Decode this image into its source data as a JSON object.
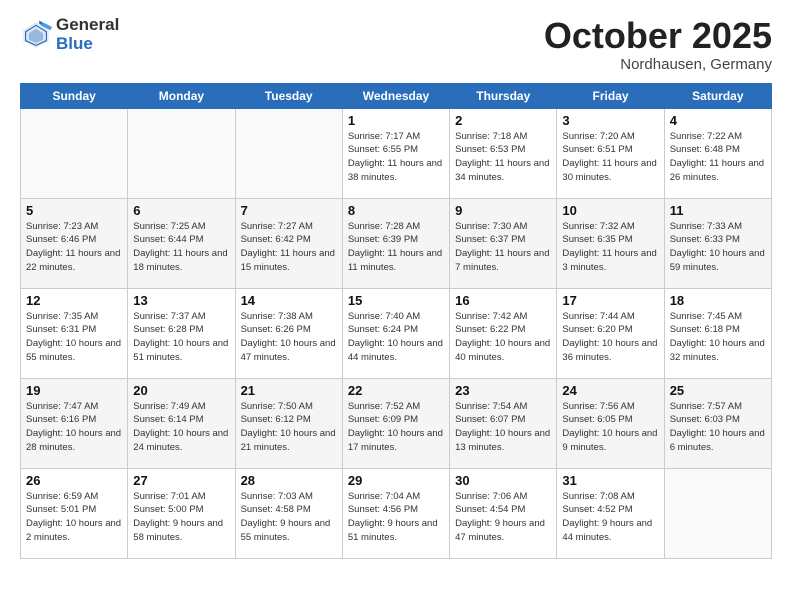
{
  "header": {
    "logo_general": "General",
    "logo_blue": "Blue",
    "month": "October 2025",
    "location": "Nordhausen, Germany"
  },
  "days_of_week": [
    "Sunday",
    "Monday",
    "Tuesday",
    "Wednesday",
    "Thursday",
    "Friday",
    "Saturday"
  ],
  "weeks": [
    [
      {
        "day": "",
        "sunrise": "",
        "sunset": "",
        "daylight": ""
      },
      {
        "day": "",
        "sunrise": "",
        "sunset": "",
        "daylight": ""
      },
      {
        "day": "",
        "sunrise": "",
        "sunset": "",
        "daylight": ""
      },
      {
        "day": "1",
        "sunrise": "Sunrise: 7:17 AM",
        "sunset": "Sunset: 6:55 PM",
        "daylight": "Daylight: 11 hours and 38 minutes."
      },
      {
        "day": "2",
        "sunrise": "Sunrise: 7:18 AM",
        "sunset": "Sunset: 6:53 PM",
        "daylight": "Daylight: 11 hours and 34 minutes."
      },
      {
        "day": "3",
        "sunrise": "Sunrise: 7:20 AM",
        "sunset": "Sunset: 6:51 PM",
        "daylight": "Daylight: 11 hours and 30 minutes."
      },
      {
        "day": "4",
        "sunrise": "Sunrise: 7:22 AM",
        "sunset": "Sunset: 6:48 PM",
        "daylight": "Daylight: 11 hours and 26 minutes."
      }
    ],
    [
      {
        "day": "5",
        "sunrise": "Sunrise: 7:23 AM",
        "sunset": "Sunset: 6:46 PM",
        "daylight": "Daylight: 11 hours and 22 minutes."
      },
      {
        "day": "6",
        "sunrise": "Sunrise: 7:25 AM",
        "sunset": "Sunset: 6:44 PM",
        "daylight": "Daylight: 11 hours and 18 minutes."
      },
      {
        "day": "7",
        "sunrise": "Sunrise: 7:27 AM",
        "sunset": "Sunset: 6:42 PM",
        "daylight": "Daylight: 11 hours and 15 minutes."
      },
      {
        "day": "8",
        "sunrise": "Sunrise: 7:28 AM",
        "sunset": "Sunset: 6:39 PM",
        "daylight": "Daylight: 11 hours and 11 minutes."
      },
      {
        "day": "9",
        "sunrise": "Sunrise: 7:30 AM",
        "sunset": "Sunset: 6:37 PM",
        "daylight": "Daylight: 11 hours and 7 minutes."
      },
      {
        "day": "10",
        "sunrise": "Sunrise: 7:32 AM",
        "sunset": "Sunset: 6:35 PM",
        "daylight": "Daylight: 11 hours and 3 minutes."
      },
      {
        "day": "11",
        "sunrise": "Sunrise: 7:33 AM",
        "sunset": "Sunset: 6:33 PM",
        "daylight": "Daylight: 10 hours and 59 minutes."
      }
    ],
    [
      {
        "day": "12",
        "sunrise": "Sunrise: 7:35 AM",
        "sunset": "Sunset: 6:31 PM",
        "daylight": "Daylight: 10 hours and 55 minutes."
      },
      {
        "day": "13",
        "sunrise": "Sunrise: 7:37 AM",
        "sunset": "Sunset: 6:28 PM",
        "daylight": "Daylight: 10 hours and 51 minutes."
      },
      {
        "day": "14",
        "sunrise": "Sunrise: 7:38 AM",
        "sunset": "Sunset: 6:26 PM",
        "daylight": "Daylight: 10 hours and 47 minutes."
      },
      {
        "day": "15",
        "sunrise": "Sunrise: 7:40 AM",
        "sunset": "Sunset: 6:24 PM",
        "daylight": "Daylight: 10 hours and 44 minutes."
      },
      {
        "day": "16",
        "sunrise": "Sunrise: 7:42 AM",
        "sunset": "Sunset: 6:22 PM",
        "daylight": "Daylight: 10 hours and 40 minutes."
      },
      {
        "day": "17",
        "sunrise": "Sunrise: 7:44 AM",
        "sunset": "Sunset: 6:20 PM",
        "daylight": "Daylight: 10 hours and 36 minutes."
      },
      {
        "day": "18",
        "sunrise": "Sunrise: 7:45 AM",
        "sunset": "Sunset: 6:18 PM",
        "daylight": "Daylight: 10 hours and 32 minutes."
      }
    ],
    [
      {
        "day": "19",
        "sunrise": "Sunrise: 7:47 AM",
        "sunset": "Sunset: 6:16 PM",
        "daylight": "Daylight: 10 hours and 28 minutes."
      },
      {
        "day": "20",
        "sunrise": "Sunrise: 7:49 AM",
        "sunset": "Sunset: 6:14 PM",
        "daylight": "Daylight: 10 hours and 24 minutes."
      },
      {
        "day": "21",
        "sunrise": "Sunrise: 7:50 AM",
        "sunset": "Sunset: 6:12 PM",
        "daylight": "Daylight: 10 hours and 21 minutes."
      },
      {
        "day": "22",
        "sunrise": "Sunrise: 7:52 AM",
        "sunset": "Sunset: 6:09 PM",
        "daylight": "Daylight: 10 hours and 17 minutes."
      },
      {
        "day": "23",
        "sunrise": "Sunrise: 7:54 AM",
        "sunset": "Sunset: 6:07 PM",
        "daylight": "Daylight: 10 hours and 13 minutes."
      },
      {
        "day": "24",
        "sunrise": "Sunrise: 7:56 AM",
        "sunset": "Sunset: 6:05 PM",
        "daylight": "Daylight: 10 hours and 9 minutes."
      },
      {
        "day": "25",
        "sunrise": "Sunrise: 7:57 AM",
        "sunset": "Sunset: 6:03 PM",
        "daylight": "Daylight: 10 hours and 6 minutes."
      }
    ],
    [
      {
        "day": "26",
        "sunrise": "Sunrise: 6:59 AM",
        "sunset": "Sunset: 5:01 PM",
        "daylight": "Daylight: 10 hours and 2 minutes."
      },
      {
        "day": "27",
        "sunrise": "Sunrise: 7:01 AM",
        "sunset": "Sunset: 5:00 PM",
        "daylight": "Daylight: 9 hours and 58 minutes."
      },
      {
        "day": "28",
        "sunrise": "Sunrise: 7:03 AM",
        "sunset": "Sunset: 4:58 PM",
        "daylight": "Daylight: 9 hours and 55 minutes."
      },
      {
        "day": "29",
        "sunrise": "Sunrise: 7:04 AM",
        "sunset": "Sunset: 4:56 PM",
        "daylight": "Daylight: 9 hours and 51 minutes."
      },
      {
        "day": "30",
        "sunrise": "Sunrise: 7:06 AM",
        "sunset": "Sunset: 4:54 PM",
        "daylight": "Daylight: 9 hours and 47 minutes."
      },
      {
        "day": "31",
        "sunrise": "Sunrise: 7:08 AM",
        "sunset": "Sunset: 4:52 PM",
        "daylight": "Daylight: 9 hours and 44 minutes."
      },
      {
        "day": "",
        "sunrise": "",
        "sunset": "",
        "daylight": ""
      }
    ]
  ]
}
